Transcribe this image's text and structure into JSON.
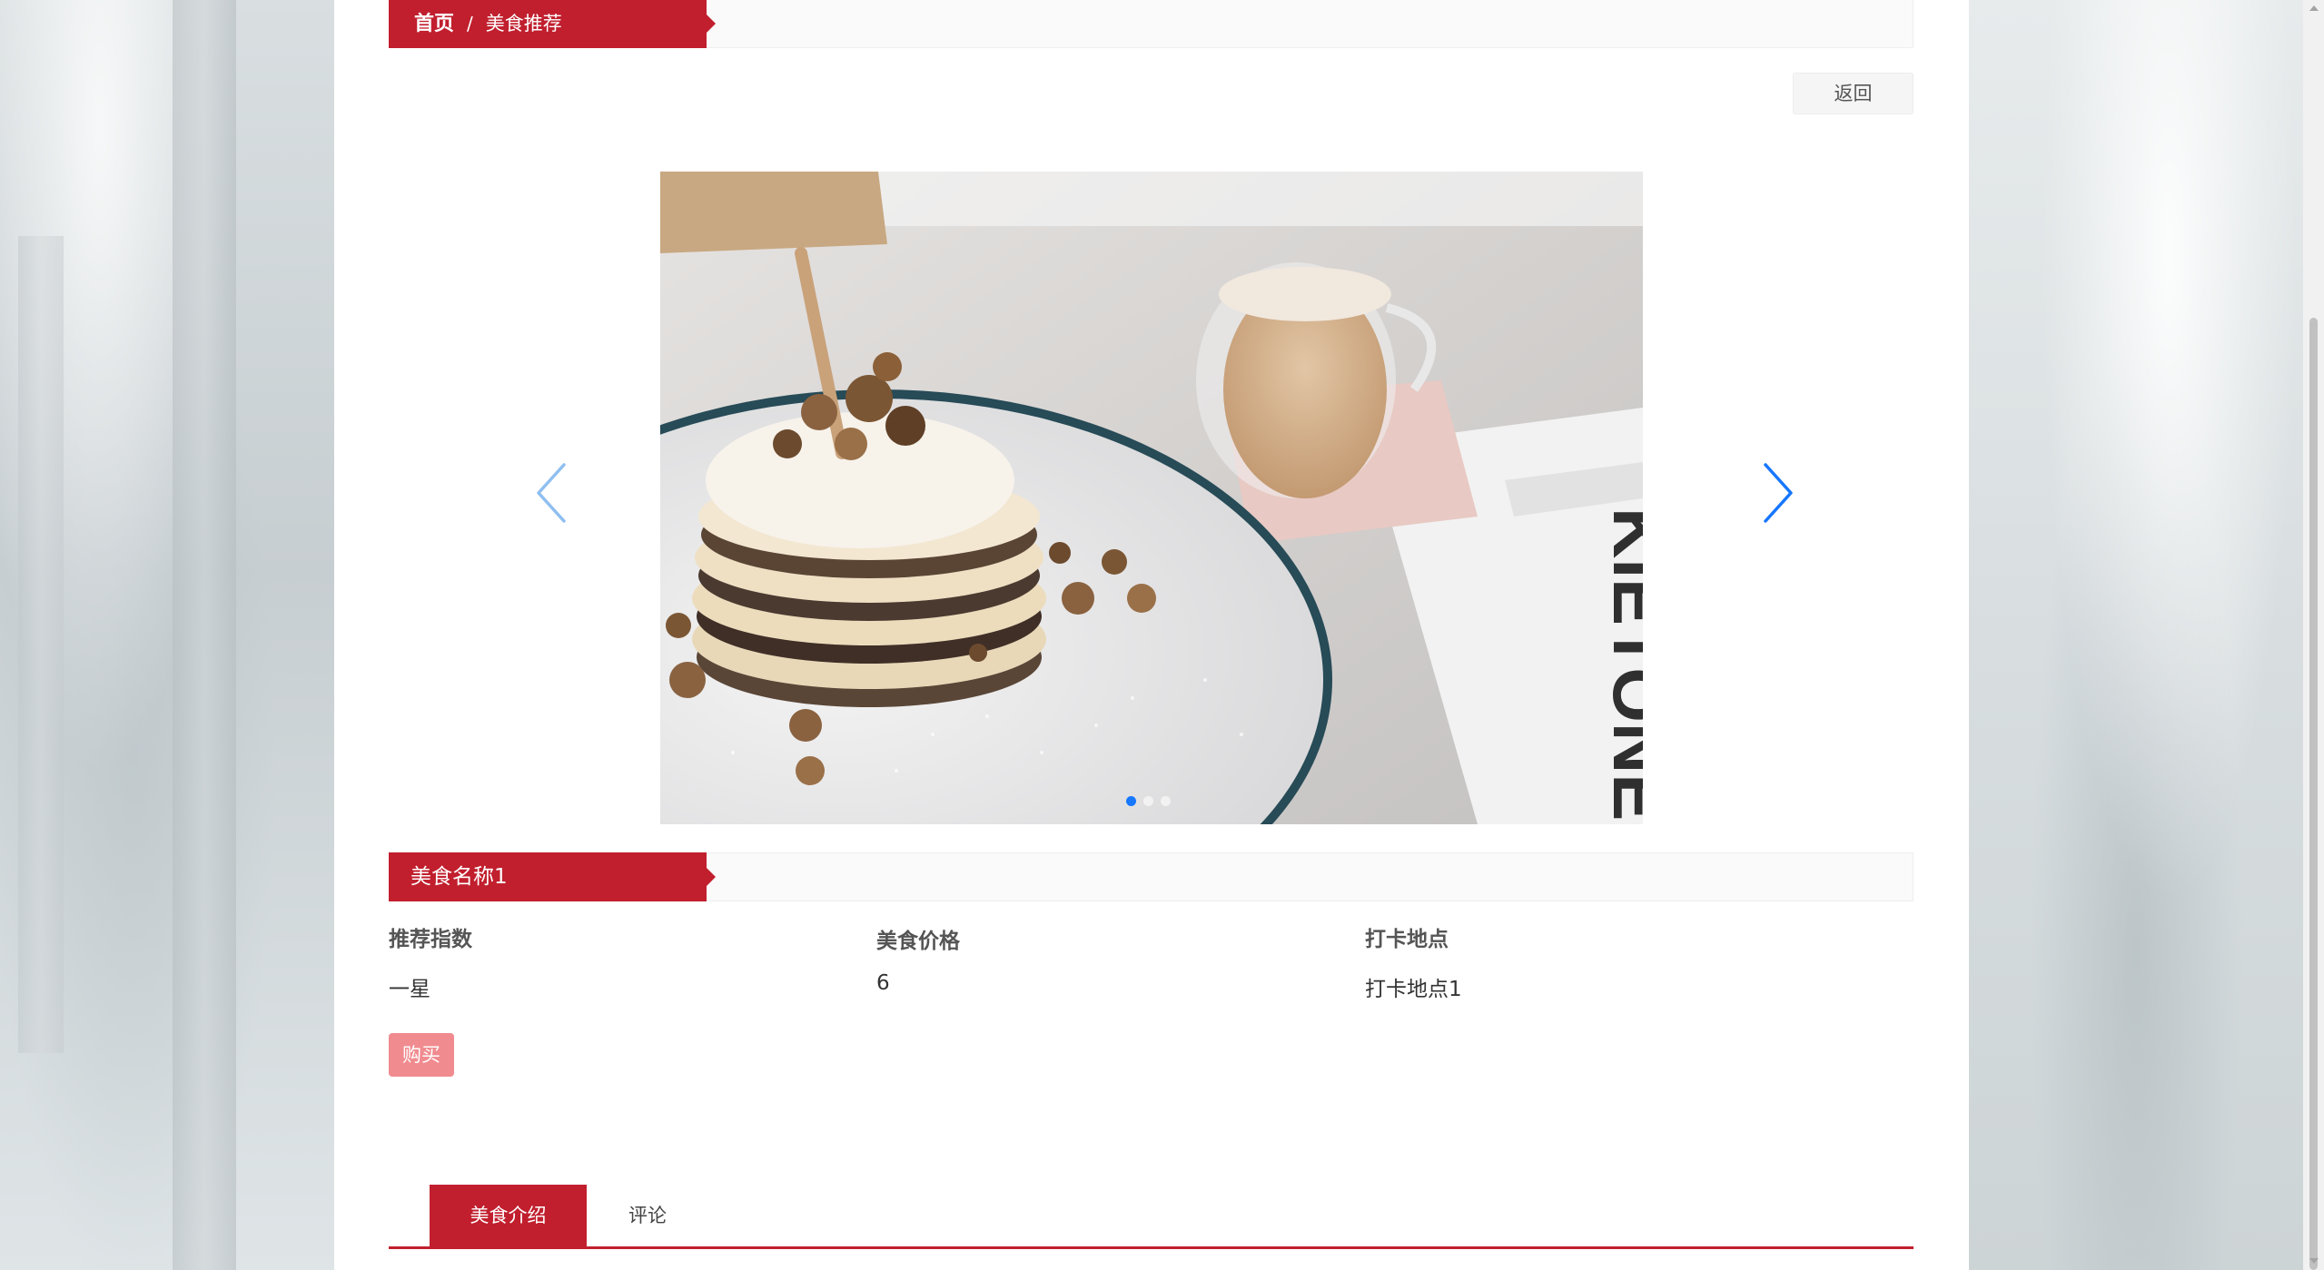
{
  "breadcrumb": {
    "home": "首页",
    "separator": "/",
    "current": "美食推荐"
  },
  "back_button": "返回",
  "carousel": {
    "slide_count": 3,
    "active_index": 0,
    "prev_icon": "chevron-left-icon",
    "next_icon": "chevron-right-icon",
    "photo_text": "KIETONE"
  },
  "food": {
    "name": "美食名称1",
    "fields": [
      {
        "label": "推荐指数",
        "value": "一星"
      },
      {
        "label": "美食价格",
        "value": "6"
      },
      {
        "label": "打卡地点",
        "value": "打卡地点1"
      }
    ],
    "buy_label": "购买"
  },
  "tabs": [
    {
      "label": "美食介绍",
      "active": true
    },
    {
      "label": "评论",
      "active": false
    }
  ],
  "colors": {
    "accent": "#c11f2e",
    "buy_button": "#f08b8f",
    "carousel_arrow": "#1677ff"
  }
}
